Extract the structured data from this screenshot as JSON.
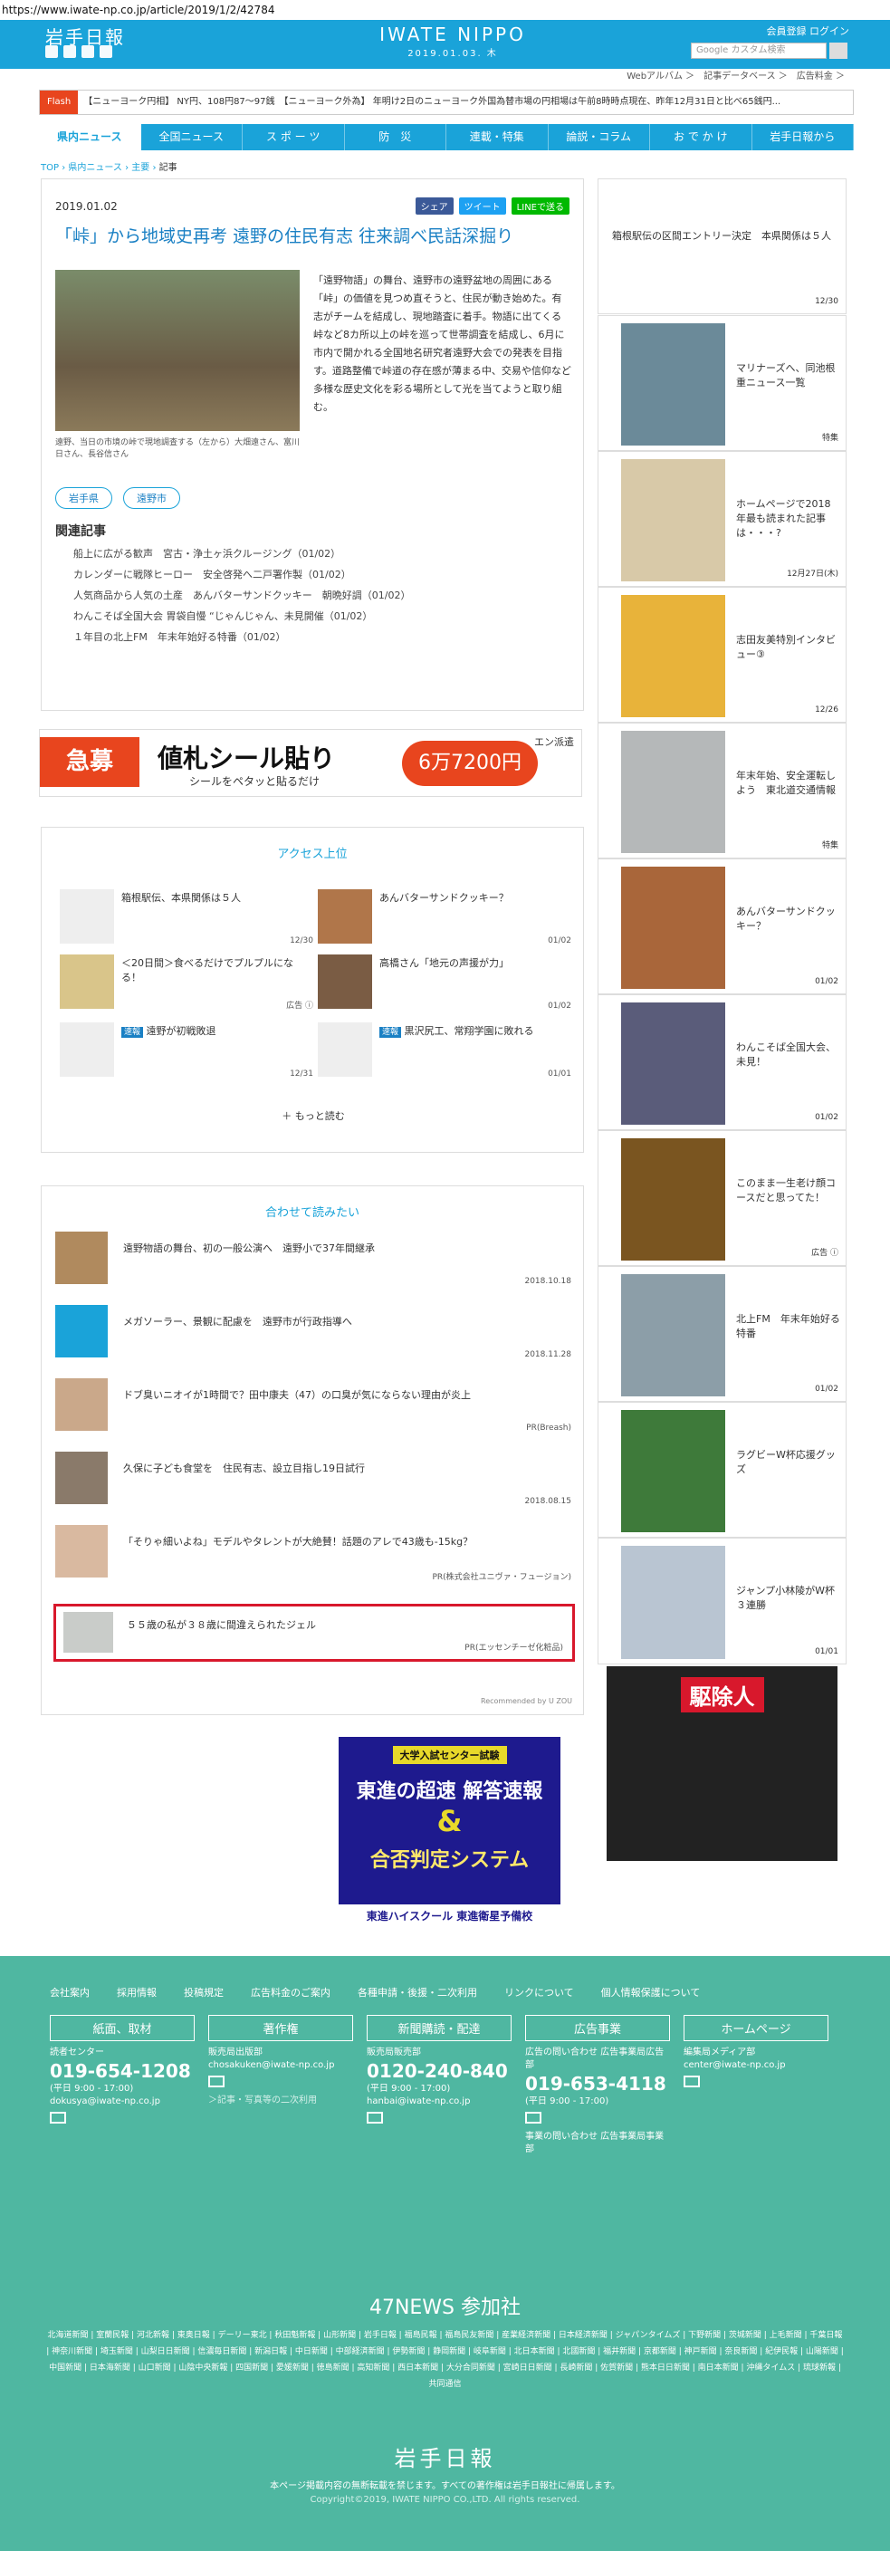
{
  "url": "https://www.iwate-np.co.jp/article/2019/1/2/42784",
  "header": {
    "logo": "岩手日報",
    "site_name": "IWATE NIPPO",
    "date": "2019.01.03. 木",
    "links": "会員登録 ログイン",
    "search_placeholder": "Google カスタム検索"
  },
  "subnav": "Webアルバム ＞　記事データベース ＞　広告料金 ＞",
  "flash": {
    "label": "Flash",
    "text": "【ニューヨーク円相】 NY円、108円87〜97銭　【ニューヨーク外為】 年明け2日のニューヨーク外国為替市場の円相場は午前8時時点現在、昨年12月31日と比べ65銭円..."
  },
  "nav": [
    "県内ニュース",
    "全国ニュース",
    "ス ポ ー ツ",
    "防　災",
    "連載・特集",
    "論説・コラム",
    "お で か け",
    "岩手日報から"
  ],
  "breadcrumb": {
    "top": "TOP",
    "sep": "›",
    "a": "県内ニュース",
    "b": "主要",
    "current": "記事"
  },
  "article": {
    "date": "2019.01.02",
    "share": [
      "シェア",
      "ツイート",
      "LINEで送る"
    ],
    "title": "「峠」から地域史再考 遠野の住民有志 往来調べ民話深掘り",
    "caption": "遠野、当日の市境の峠で現地調査する（左から）大畑遠さん、富川日さん、長谷信さん",
    "body": "「遠野物語」の舞台、遠野市の遠野盆地の周囲にある「峠」の価値を見つめ直そうと、住民が動き始めた。有志がチームを結成し、現地踏査に着手。物語に出てくる峠など8カ所以上の峠を巡って世帯調査を結成し、6月に市内で開かれる全国地名研究者遠野大会での発表を目指す。道路整備で峠道の存在感が薄まる中、交易や信仰など多様な歴史文化を彩る場所として光を当てようと取り組む。",
    "tags": [
      "岩手県",
      "遠野市"
    ],
    "related_title": "関連記事",
    "related": [
      "船上に広がる歓声　宮古・浄土ヶ浜クルージング（01/02）",
      "カレンダーに戦隊ヒーロー　安全啓発へ二戸署作製（01/02）",
      "人気商品から人気の土産　あんバターサンドクッキー　朝晩好調（01/02）",
      "わんこそば全国大会 胃袋自慢 “じゃんじゃん、未見開催（01/02）",
      "１年目の北上FM　年末年始好る特番（01/02）"
    ]
  },
  "ad1": {
    "tag": "急募",
    "main": "値札シール貼り",
    "sub": "シールをペタッと貼るだけ",
    "pay": "6万7200円",
    "brand": "エン派遣"
  },
  "access": {
    "title": "アクセス上位",
    "items": [
      {
        "text": "箱根駅伝、本県関係は５人",
        "date": "12/30"
      },
      {
        "text": "あんバターサンドクッキー？",
        "date": "01/02"
      },
      {
        "text": "＜20日間＞食べるだけでプルプルになる！",
        "date": "広告 ⓘ"
      },
      {
        "text": "高橋さん「地元の声援が力」",
        "date": "01/02"
      },
      {
        "badge": "速報",
        "text": "遠野が初戦敗退",
        "date": "12/31"
      },
      {
        "badge": "速報",
        "text": "黒沢尻工、常翔学園に敗れる",
        "date": "01/01"
      }
    ],
    "more": "もっと読む"
  },
  "recommend": {
    "title": "合わせて読みたい",
    "items": [
      {
        "text": "遠野物語の舞台、初の一般公演へ　遠野小で37年間継承",
        "date": "2018.10.18"
      },
      {
        "text": "メガソーラー、景観に配慮を　遠野市が行政指導へ",
        "date": "2018.11.28"
      },
      {
        "text": "ドブ臭いニオイが1時間で？田中康夫（47）の口臭が気にならない理由が炎上",
        "date": "PR(Breash)"
      },
      {
        "text": "久保に子ども食堂を　住民有志、設立目指し19日試行",
        "date": "2018.08.15"
      },
      {
        "text": "「そりゃ細いよね」モデルやタレントが大絶賛！話題のアレで43歳も-15kg？",
        "date": "PR(株式会社ユニヴァ・フュージョン)"
      },
      {
        "text": "５５歳の私が３８歳に間違えられたジェル",
        "date": "PR(エッセンチーゼ化粧品)"
      }
    ],
    "by": "Recommended by U ZOU"
  },
  "sidebar": [
    {
      "text": "箱根駅伝の区間エントリー決定　本県関係は５人",
      "date": "12/30"
    },
    {
      "text": "マリナーズへ、同池根重ニュース一覧",
      "date": "特集"
    },
    {
      "text": "ホームページで2018年最も読まれた記事は・・・?",
      "date": "12月27日(木)"
    },
    {
      "text": "志田友美特別インタビュー③",
      "date": "12/26"
    },
    {
      "text": "年末年始、安全運転しよう　東北道交通情報",
      "date": "特集"
    },
    {
      "text": "あんバターサンドクッキー？",
      "date": "01/02"
    },
    {
      "text": "わんこそば全国大会、未見！",
      "date": "01/02"
    },
    {
      "text": "このまま一生老け顔コースだと思ってた！",
      "date": "広告 ⓘ"
    },
    {
      "text": "北上FM　年末年始好る特番",
      "date": "01/02"
    },
    {
      "text": "ラグビーW杯応援グッズ",
      "date": ""
    },
    {
      "text": "ジャンプ小林陵がW杯３連勝",
      "date": "01/01"
    }
  ],
  "manga": {
    "title": "駆除人"
  },
  "ad2": {
    "top": "大学入試センター試験",
    "line1": "東進の超速 解答速報",
    "amp": "&",
    "line2": "合否判定システム",
    "brand": "東進ハイスクール 東進衛星予備校"
  },
  "footer": {
    "links": [
      "会社案内",
      "採用情報",
      "投稿規定",
      "広告料金のご案内",
      "各種申請・後援・二次利用",
      "リンクについて",
      "個人情報保護について"
    ],
    "cols": [
      {
        "h": "紙面、取材",
        "l1": "読者センター",
        "n": "019-654-1208",
        "l2": "(平日 9:00 - 17:00)",
        "l3": "dokusya@iwate-np.co.jp"
      },
      {
        "h": "著作権",
        "l1": "販売局出版部",
        "n": "",
        "l2": "chosakuken@iwate-np.co.jp",
        "l3": "＞記事・写真等の二次利用"
      },
      {
        "h": "新聞購読・配達",
        "l1": "販売局販売部",
        "n": "0120-240-840",
        "l2": "(平日 9:00 - 17:00)",
        "l3": "hanbai@iwate-np.co.jp"
      },
      {
        "h": "広告事業",
        "l1": "広告の問い合わせ 広告事業局広告部",
        "n": "019-653-4118",
        "l2": "(平日 9:00 - 17:00)",
        "l3": "事業の問い合わせ 広告事業局事業部"
      },
      {
        "h": "ホームページ",
        "l1": "編集局メディア部",
        "n": "",
        "l2": "center@iwate-np.co.jp",
        "l3": ""
      }
    ],
    "news47": "47NEWS 参加社",
    "papers": "北海道新聞 | 室蘭民報 | 河北新報 | 東奥日報 | デーリー東北 | 秋田魁新報 | 山形新聞 | 岩手日報 | 福島民報 | 福島民友新聞 | 産業経済新聞 | 日本経済新聞 | ジャパンタイムズ | 下野新聞 | 茨城新聞 | 上毛新聞 | 千葉日報 | 神奈川新聞 | 埼玉新聞 | 山梨日日新聞 | 信濃毎日新聞 | 新潟日報 | 中日新聞 | 中部経済新聞 | 伊勢新聞 | 静岡新聞 | 岐阜新聞 | 北日本新聞 | 北國新聞 | 福井新聞 | 京都新聞 | 神戸新聞 | 奈良新聞 | 紀伊民報 | 山陽新聞 | 中国新聞 | 日本海新聞 | 山口新聞 | 山陰中央新報 | 四国新聞 | 愛媛新聞 | 徳島新聞 | 高知新聞 | 西日本新聞 | 大分合同新聞 | 宮崎日日新聞 | 長崎新聞 | 佐賀新聞 | 熊本日日新聞 | 南日本新聞 | 沖縄タイムス | 琉球新報 | 共同通信",
    "logo": "岩手日報",
    "notice": "本ページ掲載内容の無断転載を禁じます。すべての著作権は岩手日報社に帰属します。",
    "copyright": "Copyright©2019, IWATE NIPPO CO.,LTD. All rights reserved."
  }
}
